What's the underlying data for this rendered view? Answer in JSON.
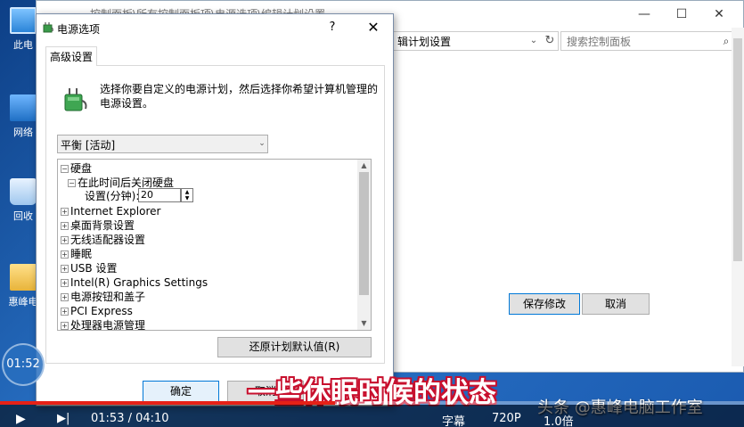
{
  "desktop": {
    "icons": [
      {
        "label": "此电"
      },
      {
        "label": "网络"
      },
      {
        "label": "回收"
      },
      {
        "label": "惠峰电"
      }
    ]
  },
  "control_panel": {
    "title": "控制面板\\所有控制面板项\\电源选项\\编辑计划设置",
    "address_tail": "辑计划设置",
    "search_placeholder": "搜索控制面板",
    "save_label": "保存修改",
    "cancel_label": "取消"
  },
  "dialog": {
    "title": "电源选项",
    "help_glyph": "?",
    "close_glyph": "✕",
    "tab_label": "高级设置",
    "intro_text": "选择你要自定义的电源计划，然后选择你希望计算机管理的电源设置。",
    "plan_value": "平衡 [活动]",
    "tree": {
      "hard_disk": "硬盘",
      "turn_off_after": "在此时间后关闭硬盘",
      "setting_label": "设置(分钟):",
      "setting_value": "20",
      "items": [
        "Internet Explorer",
        "桌面背景设置",
        "无线适配器设置",
        "睡眠",
        "USB 设置",
        "Intel(R) Graphics Settings",
        "电源按钮和盖子",
        "PCI Express",
        "处理器电源管理"
      ]
    },
    "restore_label": "还原计划默认值(R)",
    "ok_label": "确定",
    "cancel_label": "取消"
  },
  "video": {
    "elapsed_badge": "01:52",
    "subtitle": "一些休眠时候的状态",
    "watermark": "头条 @惠峰电脑工作室",
    "time_display": "01:53 / 04:10",
    "subtitle_btn": "字幕",
    "quality": "720P",
    "speed": "1.0倍",
    "progress_fraction": 0.45
  },
  "colors": {
    "accent": "#0078d7",
    "subtitle_outline": "#c8102e",
    "progress": "#e62117"
  }
}
